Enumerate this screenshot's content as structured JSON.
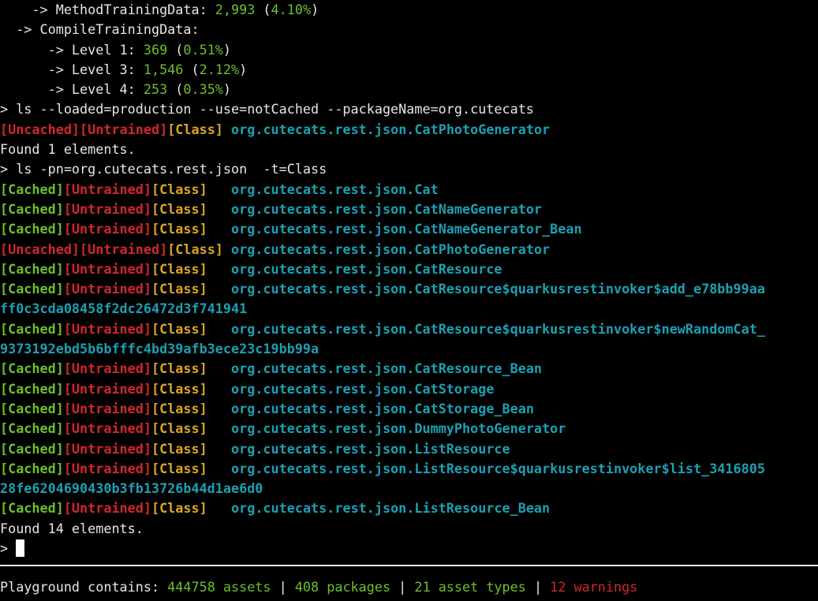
{
  "top_lines": [
    {
      "prefix": "    -> MethodTrainingData: ",
      "count": "2,993",
      "open": " (",
      "pct": "4.10%",
      "close": ")"
    },
    {
      "text": "  -> CompileTrainingData:"
    },
    {
      "prefix": "      -> Level 1: ",
      "count": "369",
      "open": " (",
      "pct": "0.51%",
      "close": ")"
    },
    {
      "prefix": "      -> Level 3: ",
      "count": "1,546",
      "open": " (",
      "pct": "2.12%",
      "close": ")"
    },
    {
      "prefix": "      -> Level 4: ",
      "count": "253",
      "open": " (",
      "pct": "0.35%",
      "close": ")"
    }
  ],
  "command1": "> ls --loaded=production --use=notCached --packageName=org.cutecats",
  "result1": [
    {
      "cache": "[Uncached]",
      "cache_state": "uncached",
      "train": "[Untrained]",
      "kind": "[Class]",
      "sep": " ",
      "name": "org.cutecats.rest.json.CatPhotoGenerator"
    }
  ],
  "found1": "Found 1 elements.",
  "command2": "> ls -pn=org.cutecats.rest.json  -t=Class",
  "result2": [
    {
      "cache": "[Cached]",
      "cache_state": "cached",
      "train": "[Untrained]",
      "kind": "[Class]",
      "sep": "   ",
      "name": "org.cutecats.rest.json.Cat"
    },
    {
      "cache": "[Cached]",
      "cache_state": "cached",
      "train": "[Untrained]",
      "kind": "[Class]",
      "sep": "   ",
      "name": "org.cutecats.rest.json.CatNameGenerator"
    },
    {
      "cache": "[Cached]",
      "cache_state": "cached",
      "train": "[Untrained]",
      "kind": "[Class]",
      "sep": "   ",
      "name": "org.cutecats.rest.json.CatNameGenerator_Bean"
    },
    {
      "cache": "[Uncached]",
      "cache_state": "uncached",
      "train": "[Untrained]",
      "kind": "[Class]",
      "sep": " ",
      "name": "org.cutecats.rest.json.CatPhotoGenerator"
    },
    {
      "cache": "[Cached]",
      "cache_state": "cached",
      "train": "[Untrained]",
      "kind": "[Class]",
      "sep": "   ",
      "name": "org.cutecats.rest.json.CatResource"
    },
    {
      "cache": "[Cached]",
      "cache_state": "cached",
      "train": "[Untrained]",
      "kind": "[Class]",
      "sep": "   ",
      "name": "org.cutecats.rest.json.CatResource$quarkusrestinvoker$add_e78bb99aa",
      "cont": "ff0c3cda08458f2dc26472d3f741941"
    },
    {
      "cache": "[Cached]",
      "cache_state": "cached",
      "train": "[Untrained]",
      "kind": "[Class]",
      "sep": "   ",
      "name": "org.cutecats.rest.json.CatResource$quarkusrestinvoker$newRandomCat_",
      "cont": "9373192ebd5b6bfffc4bd39afb3ece23c19bb99a"
    },
    {
      "cache": "[Cached]",
      "cache_state": "cached",
      "train": "[Untrained]",
      "kind": "[Class]",
      "sep": "   ",
      "name": "org.cutecats.rest.json.CatResource_Bean"
    },
    {
      "cache": "[Cached]",
      "cache_state": "cached",
      "train": "[Untrained]",
      "kind": "[Class]",
      "sep": "   ",
      "name": "org.cutecats.rest.json.CatStorage"
    },
    {
      "cache": "[Cached]",
      "cache_state": "cached",
      "train": "[Untrained]",
      "kind": "[Class]",
      "sep": "   ",
      "name": "org.cutecats.rest.json.CatStorage_Bean"
    },
    {
      "cache": "[Cached]",
      "cache_state": "cached",
      "train": "[Untrained]",
      "kind": "[Class]",
      "sep": "   ",
      "name": "org.cutecats.rest.json.DummyPhotoGenerator"
    },
    {
      "cache": "[Cached]",
      "cache_state": "cached",
      "train": "[Untrained]",
      "kind": "[Class]",
      "sep": "   ",
      "name": "org.cutecats.rest.json.ListResource"
    },
    {
      "cache": "[Cached]",
      "cache_state": "cached",
      "train": "[Untrained]",
      "kind": "[Class]",
      "sep": "   ",
      "name": "org.cutecats.rest.json.ListResource$quarkusrestinvoker$list_3416805",
      "cont": "28fe6204690430b3fb13726b44d1ae6d0"
    },
    {
      "cache": "[Cached]",
      "cache_state": "cached",
      "train": "[Untrained]",
      "kind": "[Class]",
      "sep": "   ",
      "name": "org.cutecats.rest.json.ListResource_Bean"
    }
  ],
  "found2": "Found 14 elements.",
  "prompt": "> ",
  "status": {
    "label": "Playground contains: ",
    "assets": "444758 assets",
    "sep1": " | ",
    "packages": "408 packages",
    "sep2": " | ",
    "asset_types": "21 asset types",
    "sep3": " | ",
    "warnings": "12 warnings"
  },
  "colors": {
    "background": "#000000",
    "text": "#e6e6e6",
    "green": "#6cbf2c",
    "red": "#d2262c",
    "yellow": "#d9a521",
    "cyan": "#1e9fb2"
  }
}
